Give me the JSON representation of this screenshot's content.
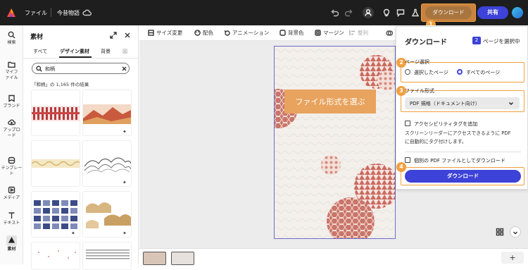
{
  "topbar": {
    "file_label": "ファイル",
    "doc_title": "今昔物語",
    "download_label": "ダウンロード",
    "share_label": "共有"
  },
  "rail": {
    "items": [
      "検索",
      "マイファイル",
      "ブランド",
      "アップロード",
      "テンプレート",
      "メディア",
      "テキスト",
      "素材"
    ]
  },
  "panel": {
    "title": "素材",
    "tabs": [
      "すべて",
      "デザイン素材",
      "背景",
      "図"
    ],
    "search_value": "和柄",
    "result_text": "「和柄」の 1,165 件の結果"
  },
  "toolbar": {
    "items": [
      "サイズ変更",
      "配色",
      "アニメーション",
      "背景色",
      "マージン",
      "整列"
    ]
  },
  "callout": {
    "text": "ファイル形式を選ぶ"
  },
  "download_panel": {
    "title": "ダウンロード",
    "page_badge": "2",
    "page_badge_text": "ページを選択中",
    "page_select_label": "ページ選択",
    "radio_selected": "選択したページ",
    "radio_all": "すべてのページ",
    "file_format_label": "ファイル形式",
    "format_value": "PDF 規格（ドキュメント向け）",
    "accessibility_label": "アクセシビリティタグを追加",
    "accessibility_desc_1": "スクリーンリーダーにアクセスできるように PDF",
    "accessibility_desc_2": "に自動的にタグ付けします。",
    "separate_pdf_label": "個別の PDF ファイルとしてダウンロード",
    "download_button": "ダウンロード"
  },
  "steps": [
    "1",
    "2",
    "3",
    "4"
  ],
  "colors": {
    "accent": "#f0a040",
    "primary": "#3d42d8",
    "topbar": "#1e1e1e"
  }
}
